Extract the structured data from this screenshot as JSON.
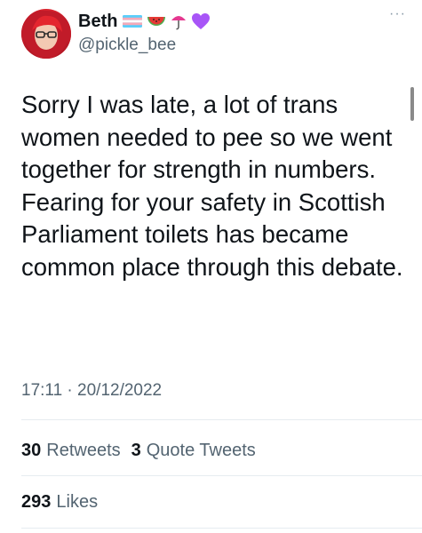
{
  "author": {
    "name": "Beth",
    "handle": "@pickle_bee",
    "flair_icons": [
      "transgender-flag-icon",
      "watermelon-icon",
      "umbrella-icon",
      "purple-heart-icon"
    ]
  },
  "tweet": {
    "text": "Sorry I was late, a lot of trans women needed to pee so we went together for strength in numbers. Fearing for your safety in Scottish Parliament toilets has became common place through this debate.",
    "time": "17:11",
    "separator": "·",
    "date": "20/12/2022"
  },
  "stats": {
    "retweets_count": "30",
    "retweets_label": "Retweets",
    "quote_count": "3",
    "quote_label": "Quote Tweets",
    "likes_count": "293",
    "likes_label": "Likes"
  },
  "menu": {
    "more_label": "···"
  },
  "colors": {
    "text": "#0f1419",
    "secondary": "#536471",
    "divider": "#e6ecf0",
    "heart": "#a855f7"
  }
}
